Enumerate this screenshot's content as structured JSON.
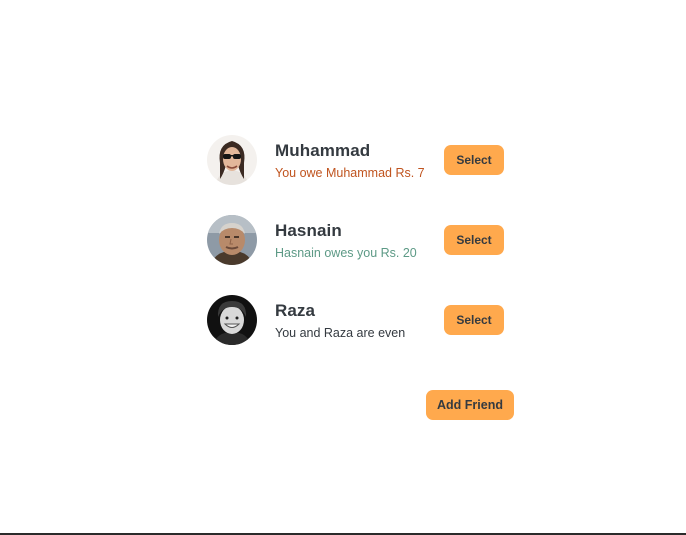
{
  "friends": [
    {
      "name": "Muhammad",
      "balance_text": "You owe Muhammad Rs. 7",
      "status": "you-owe",
      "select_label": "Select",
      "avatar_icon": "avatar-photo-man-sunglasses-long-hair"
    },
    {
      "name": "Hasnain",
      "balance_text": "Hasnain owes you Rs. 20",
      "status": "owes-you",
      "select_label": "Select",
      "avatar_icon": "avatar-photo-elderly-man"
    },
    {
      "name": "Raza",
      "balance_text": "You and Raza are even",
      "status": "even",
      "select_label": "Select",
      "avatar_icon": "avatar-photo-young-man-bw"
    }
  ],
  "add_friend_label": "Add Friend",
  "colors": {
    "button": "#ffa94d",
    "text": "#343a40",
    "owe": "#c0541f",
    "owed": "#5d9a86"
  }
}
